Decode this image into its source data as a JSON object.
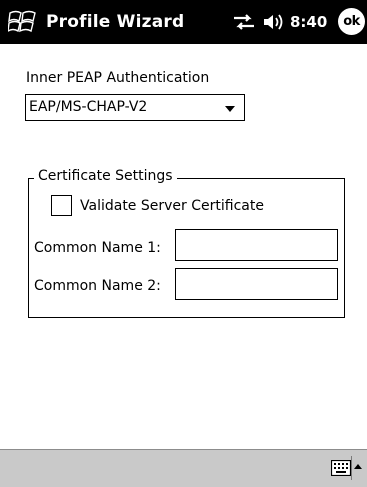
{
  "titlebar": {
    "title": "Profile Wizard",
    "clock": "8:40",
    "ok_label": "ok"
  },
  "form": {
    "peap_label": "Inner PEAP Authentication",
    "peap_selected": "EAP/MS-CHAP-V2",
    "certificate_group_title": "Certificate Settings",
    "validate_label": "Validate Server Certificate",
    "validate_checked": false,
    "common_name_1_label": "Common Name 1:",
    "common_name_1_value": "",
    "common_name_2_label": "Common Name 2:",
    "common_name_2_value": ""
  },
  "icons": {
    "start": "windows-flag-icon",
    "connectivity": "connectivity-icon",
    "volume": "volume-icon",
    "keyboard": "keyboard-icon",
    "sip": "chevron-up-icon"
  },
  "colors": {
    "titlebar_bg": "#000000",
    "menubar_bg": "#c9c9c9"
  }
}
